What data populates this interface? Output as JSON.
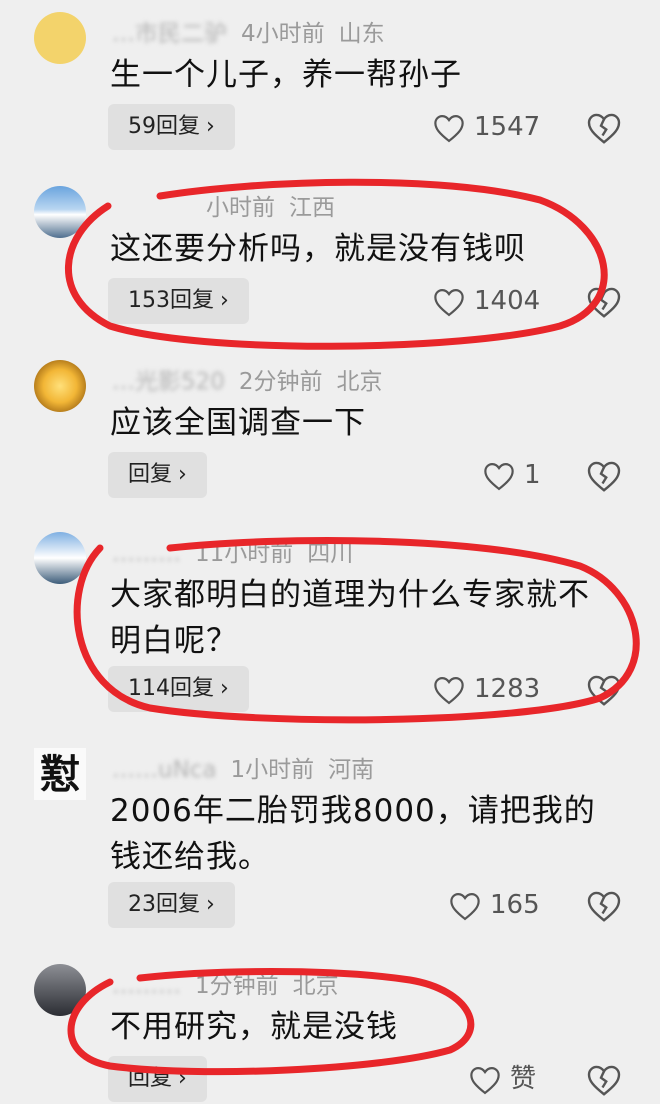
{
  "comments": [
    {
      "username": "…市民二驴",
      "time": "4小时前",
      "location": "山东",
      "text": "生一个儿子，养一帮孙子",
      "reply_label": "59回复",
      "likes": "1547"
    },
    {
      "username": "",
      "time": "小时前",
      "location": "江西",
      "text": "这还要分析吗，就是没有钱呗",
      "reply_label": "153回复",
      "likes": "1404"
    },
    {
      "username": "…光影520",
      "time": "2分钟前",
      "location": "北京",
      "text": "应该全国调查一下",
      "reply_label": "回复",
      "likes": "1"
    },
    {
      "username": "………",
      "time": "11小时前",
      "location": "四川",
      "text": "大家都明白的道理为什么专家就不明白呢？",
      "reply_label": "114回复",
      "likes": "1283"
    },
    {
      "username": "……uNca",
      "time": "1小时前",
      "location": "河南",
      "text": "2006年二胎罚我8000，请把我的钱还给我。",
      "reply_label": "23回复",
      "likes": "165"
    },
    {
      "username": "………",
      "time": "1分钟前",
      "location": "北京",
      "text": "不用研究，就是没钱",
      "reply_label": "回复",
      "likes": "赞"
    }
  ],
  "icons": {
    "chevron": "›",
    "calligraphy_avatar_char": "懟"
  },
  "colors": {
    "annotation_red": "#e8262a",
    "background": "#efefef",
    "reply_bg": "#e0e0e0"
  }
}
